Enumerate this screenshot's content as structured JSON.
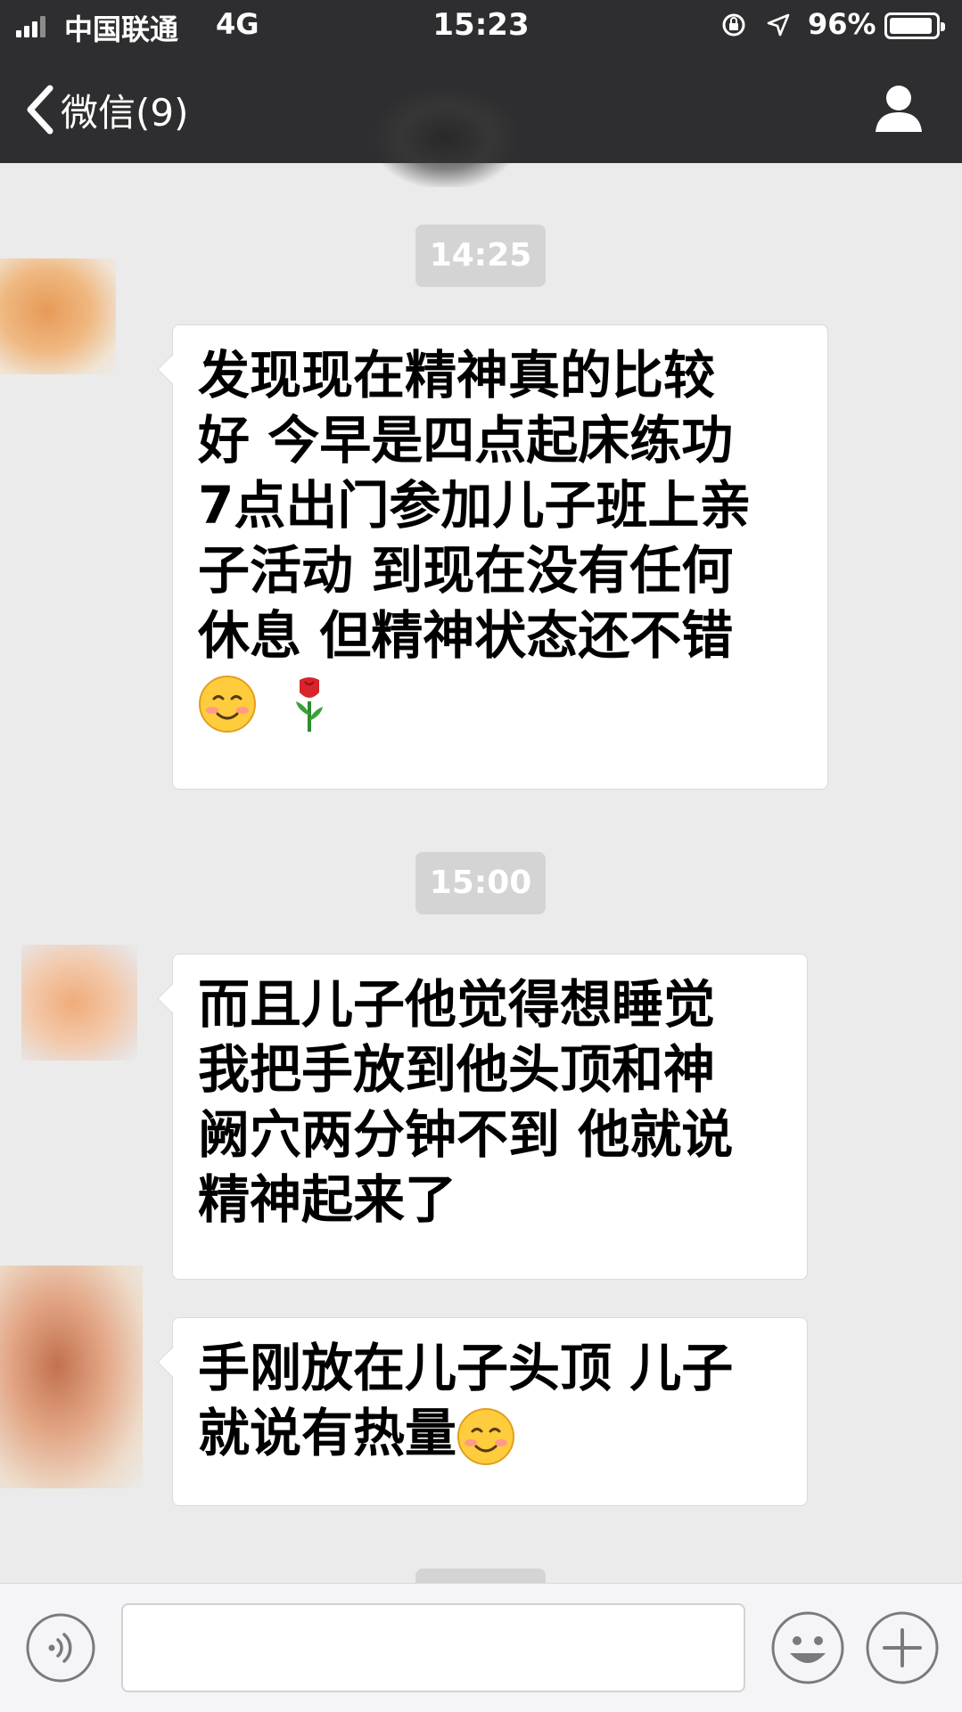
{
  "status_bar": {
    "carrier": "中国联通",
    "network": "4G",
    "time": "15:23",
    "battery_percent": "96%",
    "battery_level": 0.96
  },
  "nav": {
    "back_label": "微信(9)",
    "back_icon": "chevron-left-icon",
    "profile_icon": "person-icon"
  },
  "messages": [
    {
      "timestamp": "14:25"
    },
    {
      "lines": [
        "发现现在精神真的比较",
        "好 今早是四点起床练功",
        "7点出门参加儿子班上亲",
        "子活动 到现在没有任何",
        "休息 但精神状态还不错"
      ],
      "emojis": [
        "smiling-face-emoji",
        "rose-emoji"
      ]
    },
    {
      "timestamp": "15:00"
    },
    {
      "lines": [
        "而且儿子他觉得想睡觉",
        "我把手放到他头顶和神",
        "阙穴两分钟不到 他就说",
        "精神起来了"
      ]
    },
    {
      "lines": [
        "手刚放在儿子头顶 儿子",
        "就说有热量"
      ],
      "emojis": [
        "smiling-face-emoji"
      ]
    }
  ],
  "input_bar": {
    "voice_icon": "voice-icon",
    "input_value": "",
    "emoji_icon": "emoji-icon",
    "plus_icon": "plus-icon"
  },
  "colors": {
    "header_bg": "#2e2e30",
    "chat_bg": "#ebebeb",
    "bubble_bg": "#ffffff",
    "timestamp_bg": "#d4d4d4"
  }
}
